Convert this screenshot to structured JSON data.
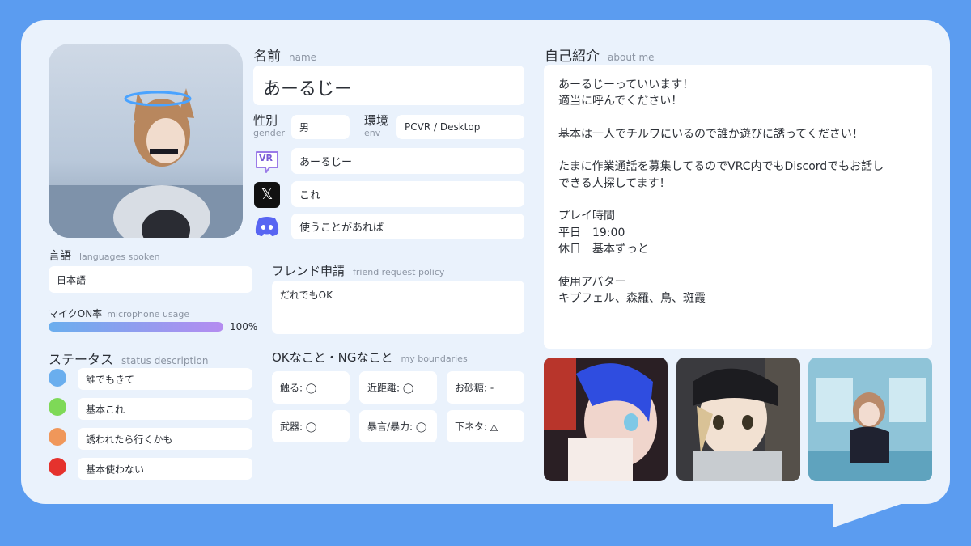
{
  "profile": {
    "name_label": "名前",
    "name_sub": "name",
    "name_value": "あーるじー",
    "gender_label": "性別",
    "gender_sub": "gender",
    "gender_value": "男",
    "env_label": "環境",
    "env_sub": "env",
    "env_value": "PCVR / Desktop",
    "vrchat_value": "あーるじー",
    "x_value": "これ",
    "discord_value": "使うことがあれば",
    "vr_icon_text": "VR",
    "x_icon_text": "𝕏"
  },
  "language": {
    "label": "言語",
    "sub": "languages spoken",
    "value": "日本語"
  },
  "mic": {
    "label": "マイクON率",
    "sub": "microphone usage",
    "percent_text": "100%",
    "fraction": 1.0
  },
  "status": {
    "label": "ステータス",
    "sub": "status description",
    "items": [
      {
        "color": "#6aaeee",
        "text": "誰でもきて"
      },
      {
        "color": "#7ed957",
        "text": "基本これ"
      },
      {
        "color": "#f0975a",
        "text": "誘われたら行くかも"
      },
      {
        "color": "#e5322d",
        "text": "基本使わない"
      }
    ]
  },
  "friend": {
    "label": "フレンド申請",
    "sub": "friend request policy",
    "value": "だれでもOK"
  },
  "boundaries": {
    "label": "OKなこと・NGなこと",
    "sub": "my boundaries",
    "items": [
      "触る: ◯",
      "近距離: ◯",
      "お砂糖: -",
      "武器: ◯",
      "暴言/暴力: ◯",
      "下ネタ: △"
    ]
  },
  "about": {
    "label": "自己紹介",
    "sub": "about me",
    "lines": [
      "あーるじーっていいます！",
      "適当に呼んでください！",
      "",
      "基本は一人でチルワにいるので誰か遊びに誘ってください！",
      "",
      "たまに作業通話を募集してるのでVRC内でもDiscordでもお話し",
      "できる人探してます！",
      "",
      "プレイ時間",
      "平日　19:00",
      "休日　基本ずっと",
      "",
      "使用アバター",
      "キプフェル、森羅、鳥、斑霞"
    ]
  },
  "colors": {
    "background": "#5b9cf0",
    "card": "#eaf2fc",
    "discord": "#5865f2",
    "vr_icon": "#9b7be8",
    "mic_bar_start": "#6aaeee",
    "mic_bar_end": "#b58cf0"
  }
}
